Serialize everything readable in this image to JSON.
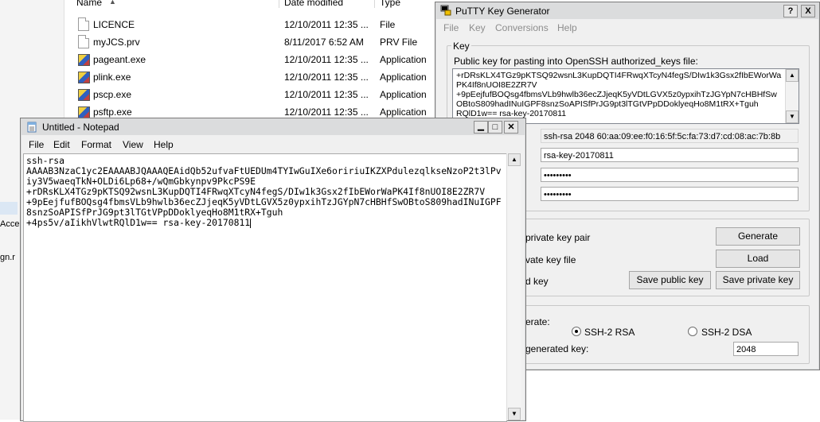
{
  "explorer": {
    "columns": {
      "name": "Name",
      "date": "Date modified",
      "type": "Type"
    },
    "files": [
      {
        "name": "LICENCE",
        "date": "12/10/2011 12:35 ...",
        "type": "File",
        "icon": "document-icon"
      },
      {
        "name": "myJCS.prv",
        "date": "8/11/2017 6:52 AM",
        "type": "PRV File",
        "icon": "document-icon"
      },
      {
        "name": "pageant.exe",
        "date": "12/10/2011 12:35 ...",
        "type": "Application",
        "icon": "pageant-icon"
      },
      {
        "name": "plink.exe",
        "date": "12/10/2011 12:35 ...",
        "type": "Application",
        "icon": "putty-app-icon"
      },
      {
        "name": "pscp.exe",
        "date": "12/10/2011 12:35 ...",
        "type": "Application",
        "icon": "putty-app-icon"
      },
      {
        "name": "psftp.exe",
        "date": "12/10/2011 12:35 ...",
        "type": "Application",
        "icon": "putty-app-icon"
      }
    ],
    "left_pane": {
      "item1": "Acce",
      "item2": "gn.r"
    }
  },
  "putty": {
    "title": "PuTTY Key Generator",
    "help_btn": "?",
    "close_btn": "X",
    "menu": [
      "File",
      "Key",
      "Conversions",
      "Help"
    ],
    "key_group": "Key",
    "public_key_label": "Public key for pasting into OpenSSH authorized_keys file:",
    "public_key_text": "+rDRsKLX4TGz9pKTSQ92wsnL3KupDQTI4FRwqXTcyN4fegS/DIw1k3Gsx2fIbEWorWaPK4If8nUOI8E2ZR7V\n+9pEejfufBOQsg4fbmsVLb9hwlb36ecZJjeqK5yVDtLGVX5z0ypxihTzJGYpN7cHBHfSwOBtoS809hadINuIGPF8snzSoAPISfPrJG9pt3lTGtVPpDDoklyeqHo8M1tRX+Tguh\nRQlD1w== rsa-key-20170811",
    "fingerprint": "ssh-rsa 2048 60:aa:09:ee:f0:16:5f:5c:fa:73:d7:cd:08:ac:7b:8b",
    "comment": "rsa-key-20170811",
    "passphrase": "•••••••••",
    "confirm_passphrase": "•••••••••",
    "actions": {
      "generate_label": "private key pair",
      "load_label": "vate key file",
      "save_label": "d key",
      "generate_btn": "Generate",
      "load_btn": "Load",
      "save_public_btn": "Save public key",
      "save_private_btn": "Save private key"
    },
    "params": {
      "type_label": "erate:",
      "rsa_option": "SSH-2 RSA",
      "dsa_option": "SSH-2 DSA",
      "bits_label": "generated key:",
      "bits_value": "2048",
      "selected": "rsa"
    }
  },
  "notepad": {
    "title": "Untitled - Notepad",
    "menu": [
      "File",
      "Edit",
      "Format",
      "View",
      "Help"
    ],
    "content": "ssh-rsa\nAAAAB3NzaC1yc2EAAAABJQAAAQEAidQb52ufvaFtUEDUm4TYIwGuIXe6oririuIKZXPdulezqlkseNzoP2t3lPviy3V5waeqTkN+OLDi6Lp68+/wQmGbkynpv9PkcPS9E\n+rDRsKLX4TGz9pKTSQ92wsnL3KupDQTI4FRwqXTcyN4fegS/DIw1k3Gsx2fIbEWorWaPK4If8nUOI8E2ZR7V\n+9pEejfufBOQsg4fbmsVLb9hwlb36ecZJjeqK5yVDtLGVX5z0ypxihTzJGYpN7cHBHfSwOBtoS809hadINuIGPF8snzSoAPISfPrJG9pt3lTGtVPpDDoklyeqHo8M1tRX+Tguh\n+4ps5v/aIikhVlwtRQlD1w== rsa-key-20170811"
  }
}
